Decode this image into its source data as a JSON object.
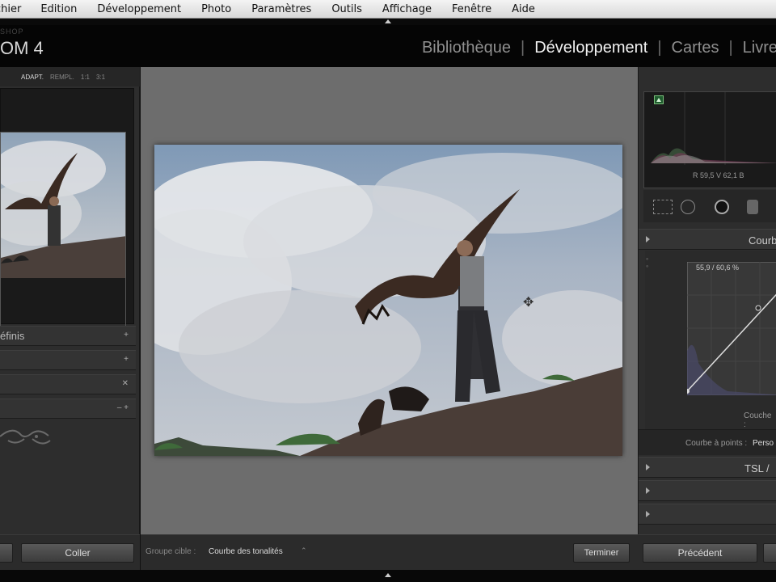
{
  "menubar": {
    "items": [
      "chier",
      "Edition",
      "Développement",
      "Photo",
      "Paramètres",
      "Outils",
      "Affichage",
      "Fenêtre",
      "Aide"
    ]
  },
  "identity": {
    "small": "SHOP",
    "large": "OM 4"
  },
  "modules": {
    "items": [
      {
        "label": "Bibliothèque",
        "active": false
      },
      {
        "label": "Développement",
        "active": true
      },
      {
        "label": "Cartes",
        "active": false
      },
      {
        "label": "Livres",
        "active": false
      }
    ]
  },
  "navigator": {
    "zoom_options": [
      "ADAPT.",
      "REMPL.",
      "1:1",
      "3:1"
    ],
    "active_zoom": "ADAPT."
  },
  "left_panels": {
    "presets_label": "éfinis",
    "row1_control": "+",
    "row2_control": "+",
    "row3_control": "✕",
    "row4_controls": "– +"
  },
  "histogram": {
    "readout": "R  59,5  V  62,1  B"
  },
  "curve_panel": {
    "title": "Courb",
    "readout": "55,9 / 60,6 %",
    "channel_label": "Couche :",
    "point_curve_label": "Courbe à points :",
    "point_curve_value": "Perso"
  },
  "tsl_panel": {
    "title": "TSL /"
  },
  "toolbar": {
    "target_label": "Groupe cible :",
    "target_value": "Courbe des tonalités",
    "done_button": "Terminer"
  },
  "bottom_left": {
    "paste_button": "Coller"
  },
  "bottom_right": {
    "previous_button": "Précédent"
  },
  "colors": {
    "accent": "#f2f2f2",
    "panel": "#2d2d2d",
    "center_bg": "#6d6d6d"
  }
}
